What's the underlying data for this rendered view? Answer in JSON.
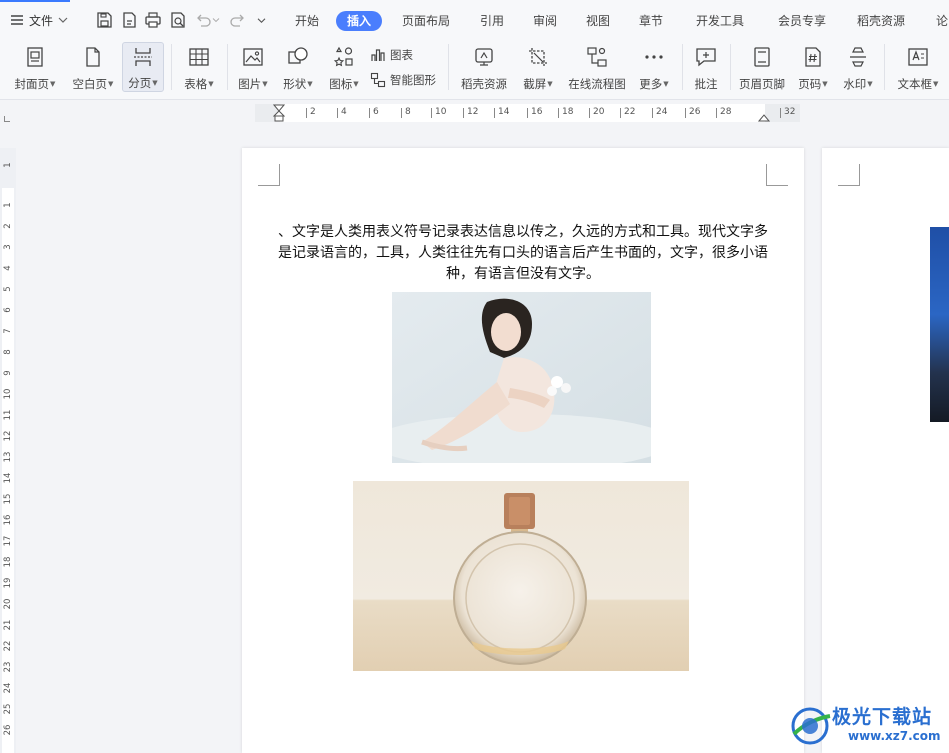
{
  "app": {
    "file_menu": "文件",
    "tabs": [
      {
        "label": "开始"
      },
      {
        "label": "插入"
      },
      {
        "label": "页面布局"
      },
      {
        "label": "引用"
      },
      {
        "label": "审阅"
      },
      {
        "label": "视图"
      },
      {
        "label": "章节"
      },
      {
        "label": "开发工具"
      },
      {
        "label": "会员专享"
      },
      {
        "label": "稻壳资源"
      },
      {
        "label": "论"
      }
    ],
    "active_tab": "插入",
    "accent_color": "#4a7efd"
  },
  "ribbon": {
    "buttons": [
      {
        "label": "封面页",
        "icon": "cover-page-icon"
      },
      {
        "label": "空白页",
        "icon": "blank-page-icon"
      },
      {
        "label": "分页",
        "icon": "page-break-icon"
      },
      {
        "label": "表格",
        "icon": "table-icon"
      },
      {
        "label": "图片",
        "icon": "picture-icon"
      },
      {
        "label": "形状",
        "icon": "shapes-icon"
      },
      {
        "label": "图标",
        "icon": "icons-icon"
      },
      {
        "label": "图表",
        "icon": "chart-icon"
      },
      {
        "label": "智能图形",
        "icon": "smartart-icon"
      },
      {
        "label": "稻壳资源",
        "icon": "docer-resource-icon"
      },
      {
        "label": "截屏",
        "icon": "screenshot-icon"
      },
      {
        "label": "在线流程图",
        "icon": "flowchart-icon"
      },
      {
        "label": "更多",
        "icon": "more-icon"
      },
      {
        "label": "批注",
        "icon": "comment-icon"
      },
      {
        "label": "页眉页脚",
        "icon": "header-footer-icon"
      },
      {
        "label": "页码",
        "icon": "page-number-icon"
      },
      {
        "label": "水印",
        "icon": "watermark-icon"
      },
      {
        "label": "文本框",
        "icon": "textbox-icon"
      }
    ]
  },
  "ruler": {
    "h_ticks": [
      "2",
      "4",
      "6",
      "8",
      "10",
      "12",
      "14",
      "16",
      "18",
      "20",
      "22",
      "24",
      "26",
      "28",
      "32"
    ],
    "v_ticks": [
      "1",
      "1",
      "2",
      "3",
      "4",
      "5",
      "6",
      "7",
      "8",
      "9",
      "10",
      "11",
      "12",
      "13",
      "14",
      "15",
      "16",
      "17",
      "18",
      "19",
      "20",
      "21",
      "22",
      "23",
      "24",
      "25",
      "26"
    ]
  },
  "document": {
    "text": "、文字是人类用表义符号记录表达信息以传之，久远的方式和工具。现代文字多是记录语言的，工具，人类往往先有口头的语言后产生书面的，文字，很多小语种，有语言但没有文字。"
  },
  "watermark": {
    "title": "极光下载站",
    "url": "www.xz7.com"
  }
}
